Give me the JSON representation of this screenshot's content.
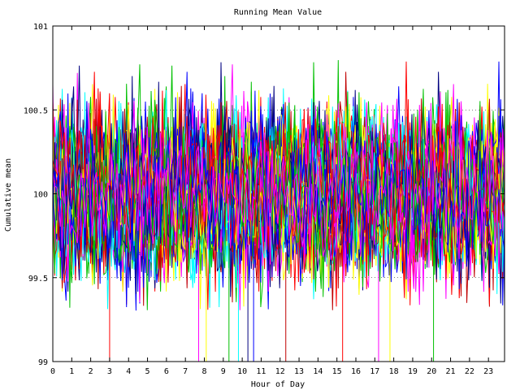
{
  "chart_data": {
    "type": "line",
    "title": "Running Mean Value",
    "xlabel": "Hour of Day",
    "ylabel": "Cumulative mean",
    "xlim": [
      0,
      23.85
    ],
    "ylim": [
      99,
      101
    ],
    "x_ticks": [
      0,
      1,
      2,
      3,
      4,
      5,
      6,
      7,
      8,
      9,
      10,
      11,
      12,
      13,
      14,
      15,
      16,
      17,
      18,
      19,
      20,
      21,
      22,
      23
    ],
    "x_tick_labels": [
      "0",
      "1",
      "2",
      "3",
      "4",
      "5",
      "6",
      "7",
      "8",
      "9",
      "10",
      "11",
      "12",
      "13",
      "14",
      "15",
      "16",
      "17",
      "18",
      "19",
      "20",
      "21",
      "22",
      "23"
    ],
    "y_ticks": [
      99,
      99.5,
      100,
      100.5,
      101
    ],
    "y_tick_labels": [
      "99",
      "99.5",
      "100",
      "100.5",
      "101"
    ],
    "grid": true,
    "legend": "none",
    "series_count": 60,
    "points_per_series": 240,
    "center_value": 100,
    "typical_spread": 0.22,
    "observed_range": [
      99.0,
      100.8
    ],
    "series_colors": [
      "#ff0000",
      "#00c000",
      "#0000ff",
      "#ff00ff",
      "#00ffff",
      "#c00000",
      "#ffff00",
      "#000080"
    ],
    "dropouts": [
      {
        "x": 3.0,
        "y": 99.0
      },
      {
        "x": 7.7,
        "y": 99.0
      },
      {
        "x": 8.1,
        "y": 99.0
      },
      {
        "x": 9.3,
        "y": 99.0
      },
      {
        "x": 9.8,
        "y": 99.0
      },
      {
        "x": 10.3,
        "y": 99.0
      },
      {
        "x": 10.6,
        "y": 99.0
      },
      {
        "x": 12.3,
        "y": 99.0
      },
      {
        "x": 15.3,
        "y": 99.0
      },
      {
        "x": 17.2,
        "y": 99.0
      },
      {
        "x": 17.8,
        "y": 99.0
      },
      {
        "x": 20.1,
        "y": 99.0
      }
    ]
  }
}
